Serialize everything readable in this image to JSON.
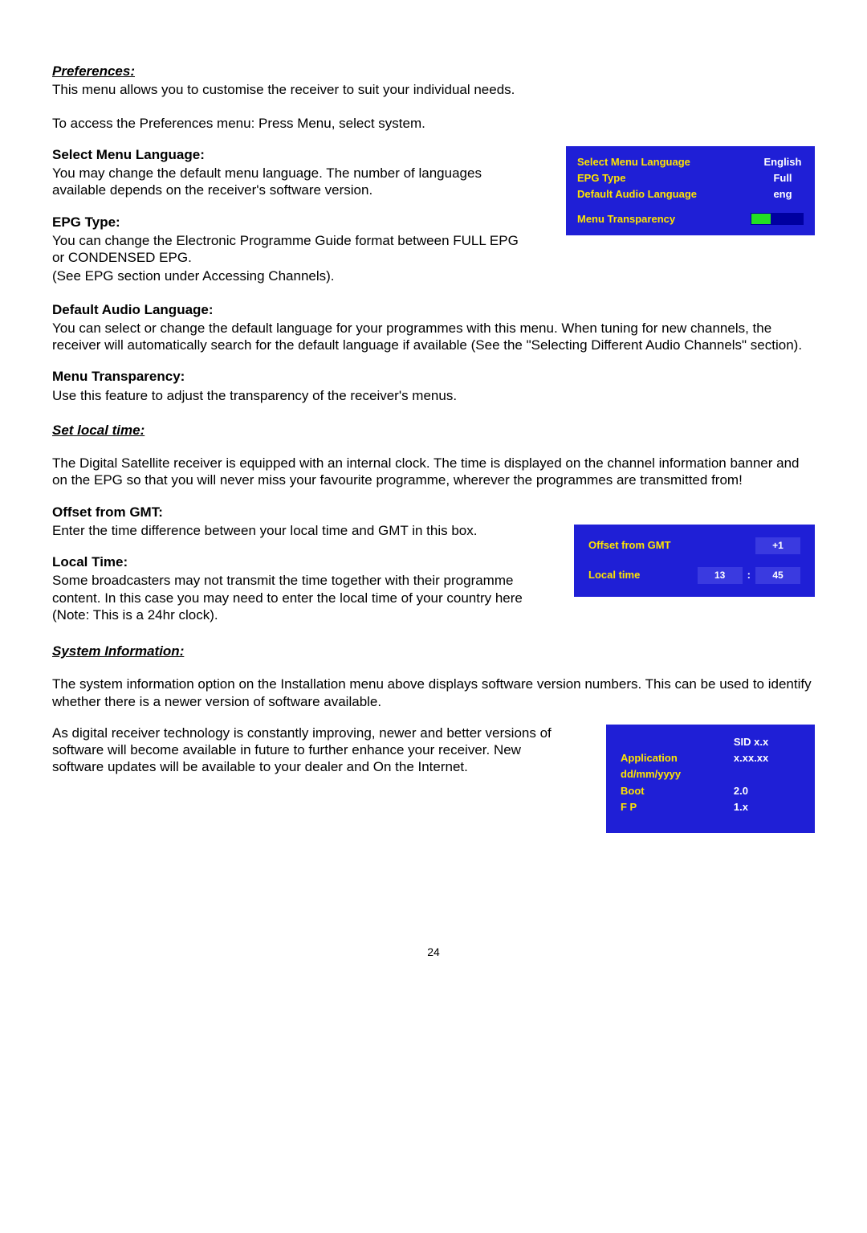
{
  "page_number": "24",
  "prefs": {
    "heading": "Preferences:",
    "intro1": "This menu allows you to customise the receiver to suit your individual needs.",
    "intro2": "To access the Preferences menu: Press Menu, select system.",
    "sml": {
      "heading": "Select Menu Language:",
      "body": "You may change the default menu language. The number of languages available depends on the receiver's software version."
    },
    "epg": {
      "heading": "EPG Type:",
      "body1": "You can change the Electronic Programme Guide format between FULL EPG or CONDENSED EPG.",
      "body2": "(See EPG section under Accessing Channels)."
    },
    "dal": {
      "heading": "Default Audio Language:",
      "body": "You can select or change the default language for your programmes with this menu. When tuning for new channels, the receiver will automatically search for the default language if available (See the \"Selecting Different Audio Channels\" section)."
    },
    "mt": {
      "heading": "Menu Transparency:",
      "body": "Use this feature to adjust the transparency of the receiver's menus."
    },
    "osd": {
      "row1_label": "Select Menu Language",
      "row1_value": "English",
      "row2_label": "EPG Type",
      "row2_value": "Full",
      "row3_label": "Default Audio Language",
      "row3_value": "eng",
      "row4_label": "Menu Transparency"
    }
  },
  "time": {
    "heading": "Set local time:",
    "intro": "The Digital Satellite receiver is equipped with an internal clock. The time is displayed on the channel information banner and on the EPG so that you will never miss your favourite programme, wherever the programmes are transmitted from!",
    "offset": {
      "heading": "Offset from GMT:",
      "body": "Enter the time difference between your local time and GMT in this box."
    },
    "local": {
      "heading": "Local Time:",
      "body": "Some broadcasters may not transmit the time together with their programme content. In this case you may need to enter the local time of your country here (Note: This is a 24hr clock)."
    },
    "osd": {
      "offset_label": "Offset from GMT",
      "offset_value": "+1",
      "local_label": "Local time",
      "hh": "13",
      "mm": "45"
    }
  },
  "sys": {
    "heading": "System Information:",
    "intro": "The system information option on the Installation menu above displays software version numbers. This can be used to identify whether there is a newer version of software available.",
    "body": "As digital receiver technology is constantly improving, newer and better versions of software will become available in future to further enhance your receiver. New software updates will be available to your dealer and On the Internet.",
    "osd": {
      "sid": "SID x.x",
      "app_label": "Application",
      "app_value": "x.xx.xx",
      "date": "dd/mm/yyyy",
      "boot_label": "Boot",
      "boot_value": "2.0",
      "fp_label": "F P",
      "fp_value": "1.x"
    }
  }
}
